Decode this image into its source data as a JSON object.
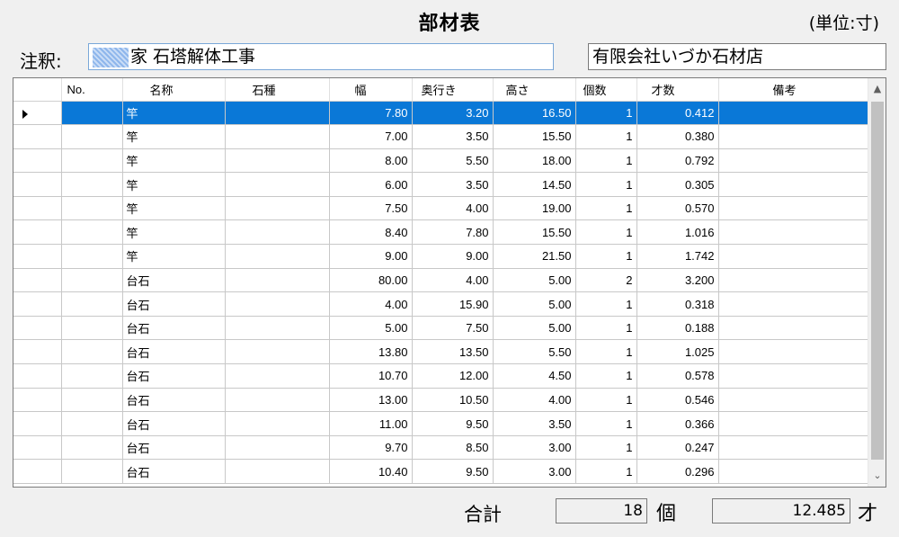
{
  "title": "部材表",
  "unit_label": "(単位:寸)",
  "note": {
    "label": "注釈:",
    "value": "家 石塔解体工事"
  },
  "company": "有限会社いづか石材店",
  "table": {
    "columns": [
      "No.",
      "名称",
      "石種",
      "幅",
      "奥行き",
      "高さ",
      "個数",
      "才数",
      "備考"
    ],
    "rows": [
      {
        "no": "",
        "name": "竿",
        "stone": "",
        "width": "7.80",
        "depth": "3.20",
        "height": "16.50",
        "count": "1",
        "size": "0.412",
        "remarks": ""
      },
      {
        "no": "",
        "name": "竿",
        "stone": "",
        "width": "7.00",
        "depth": "3.50",
        "height": "15.50",
        "count": "1",
        "size": "0.380",
        "remarks": ""
      },
      {
        "no": "",
        "name": "竿",
        "stone": "",
        "width": "8.00",
        "depth": "5.50",
        "height": "18.00",
        "count": "1",
        "size": "0.792",
        "remarks": ""
      },
      {
        "no": "",
        "name": "竿",
        "stone": "",
        "width": "6.00",
        "depth": "3.50",
        "height": "14.50",
        "count": "1",
        "size": "0.305",
        "remarks": ""
      },
      {
        "no": "",
        "name": "竿",
        "stone": "",
        "width": "7.50",
        "depth": "4.00",
        "height": "19.00",
        "count": "1",
        "size": "0.570",
        "remarks": ""
      },
      {
        "no": "",
        "name": "竿",
        "stone": "",
        "width": "8.40",
        "depth": "7.80",
        "height": "15.50",
        "count": "1",
        "size": "1.016",
        "remarks": ""
      },
      {
        "no": "",
        "name": "竿",
        "stone": "",
        "width": "9.00",
        "depth": "9.00",
        "height": "21.50",
        "count": "1",
        "size": "1.742",
        "remarks": ""
      },
      {
        "no": "",
        "name": "台石",
        "stone": "",
        "width": "80.00",
        "depth": "4.00",
        "height": "5.00",
        "count": "2",
        "size": "3.200",
        "remarks": ""
      },
      {
        "no": "",
        "name": "台石",
        "stone": "",
        "width": "4.00",
        "depth": "15.90",
        "height": "5.00",
        "count": "1",
        "size": "0.318",
        "remarks": ""
      },
      {
        "no": "",
        "name": "台石",
        "stone": "",
        "width": "5.00",
        "depth": "7.50",
        "height": "5.00",
        "count": "1",
        "size": "0.188",
        "remarks": ""
      },
      {
        "no": "",
        "name": "台石",
        "stone": "",
        "width": "13.80",
        "depth": "13.50",
        "height": "5.50",
        "count": "1",
        "size": "1.025",
        "remarks": ""
      },
      {
        "no": "",
        "name": "台石",
        "stone": "",
        "width": "10.70",
        "depth": "12.00",
        "height": "4.50",
        "count": "1",
        "size": "0.578",
        "remarks": ""
      },
      {
        "no": "",
        "name": "台石",
        "stone": "",
        "width": "13.00",
        "depth": "10.50",
        "height": "4.00",
        "count": "1",
        "size": "0.546",
        "remarks": ""
      },
      {
        "no": "",
        "name": "台石",
        "stone": "",
        "width": "11.00",
        "depth": "9.50",
        "height": "3.50",
        "count": "1",
        "size": "0.366",
        "remarks": ""
      },
      {
        "no": "",
        "name": "台石",
        "stone": "",
        "width": "9.70",
        "depth": "8.50",
        "height": "3.00",
        "count": "1",
        "size": "0.247",
        "remarks": ""
      },
      {
        "no": "",
        "name": "台石",
        "stone": "",
        "width": "10.40",
        "depth": "9.50",
        "height": "3.00",
        "count": "1",
        "size": "0.296",
        "remarks": ""
      }
    ],
    "selected_row": 0
  },
  "totals": {
    "label": "合計",
    "count": "18",
    "count_unit": "個",
    "size": "12.485",
    "size_unit": "才"
  },
  "icons": {
    "row_indicator": "current-row-arrow-icon",
    "scroll_up": "chevron-up-icon",
    "scroll_down": "chevron-down-icon"
  },
  "colors": {
    "selection": "#0a78d7",
    "note_border": "#7aa7d8"
  }
}
